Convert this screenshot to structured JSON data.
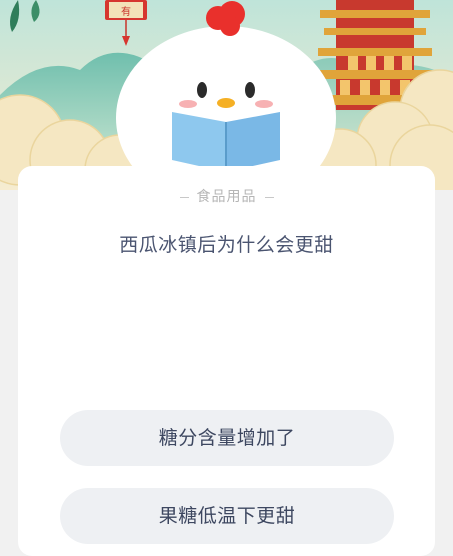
{
  "banner": {
    "plaque_text": "有"
  },
  "card": {
    "category": "食品用品",
    "question": "西瓜冰镇后为什么会更甜"
  },
  "options": [
    {
      "label": "糖分含量增加了"
    },
    {
      "label": "果糖低温下更甜"
    }
  ]
}
